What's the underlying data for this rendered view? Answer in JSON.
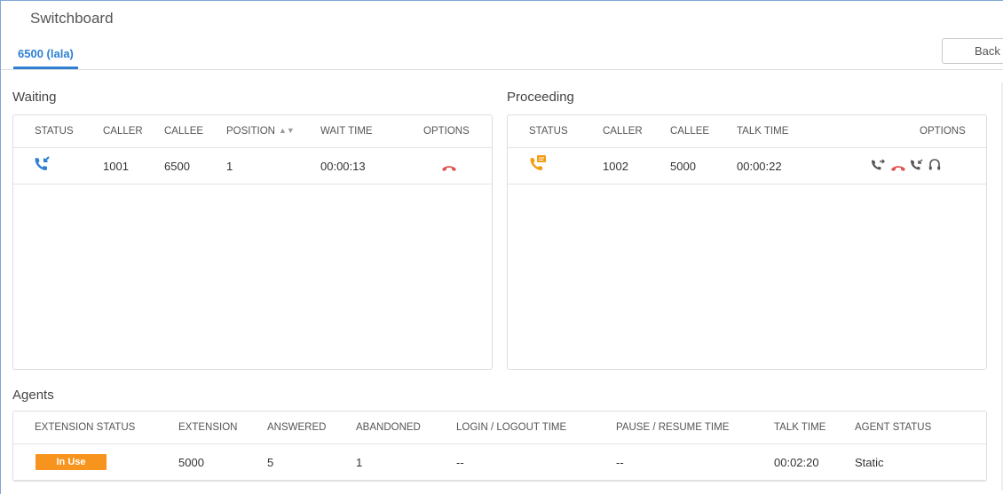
{
  "page": {
    "title": "Switchboard"
  },
  "tabs": [
    {
      "label": "6500 (lala)"
    }
  ],
  "back_label": "Back",
  "colors": {
    "accent": "#2f80d4",
    "hangup": "#e05252",
    "in_use": "#f7941d",
    "caller_icon": "#2f80d4",
    "incall_icon": "#f39c12"
  },
  "waiting": {
    "title": "Waiting",
    "columns": [
      "STATUS",
      "CALLER",
      "CALLEE",
      "POSITION",
      "WAIT TIME",
      "OPTIONS"
    ],
    "rows": [
      {
        "status_icon": "incoming-call-icon",
        "caller": "1001",
        "callee": "6500",
        "position": "1",
        "wait_time": "00:00:13",
        "options": [
          "hangup-icon"
        ]
      }
    ]
  },
  "proceeding": {
    "title": "Proceeding",
    "columns": [
      "STATUS",
      "CALLER",
      "CALLEE",
      "TALK TIME",
      "OPTIONS"
    ],
    "rows": [
      {
        "status_icon": "in-call-icon",
        "caller": "1002",
        "callee": "5000",
        "talk_time": "00:00:22",
        "options": [
          "transfer-icon",
          "hangup-icon",
          "call-barge-icon",
          "headset-icon"
        ]
      }
    ]
  },
  "agents": {
    "title": "Agents",
    "columns": [
      "EXTENSION STATUS",
      "EXTENSION",
      "ANSWERED",
      "ABANDONED",
      "LOGIN / LOGOUT TIME",
      "PAUSE / RESUME TIME",
      "TALK TIME",
      "AGENT STATUS"
    ],
    "rows": [
      {
        "extension_status": "In Use",
        "extension": "5000",
        "answered": "5",
        "abandoned": "1",
        "login_logout": "--",
        "pause_resume": "--",
        "talk_time": "00:02:20",
        "agent_status": "Static"
      }
    ]
  }
}
